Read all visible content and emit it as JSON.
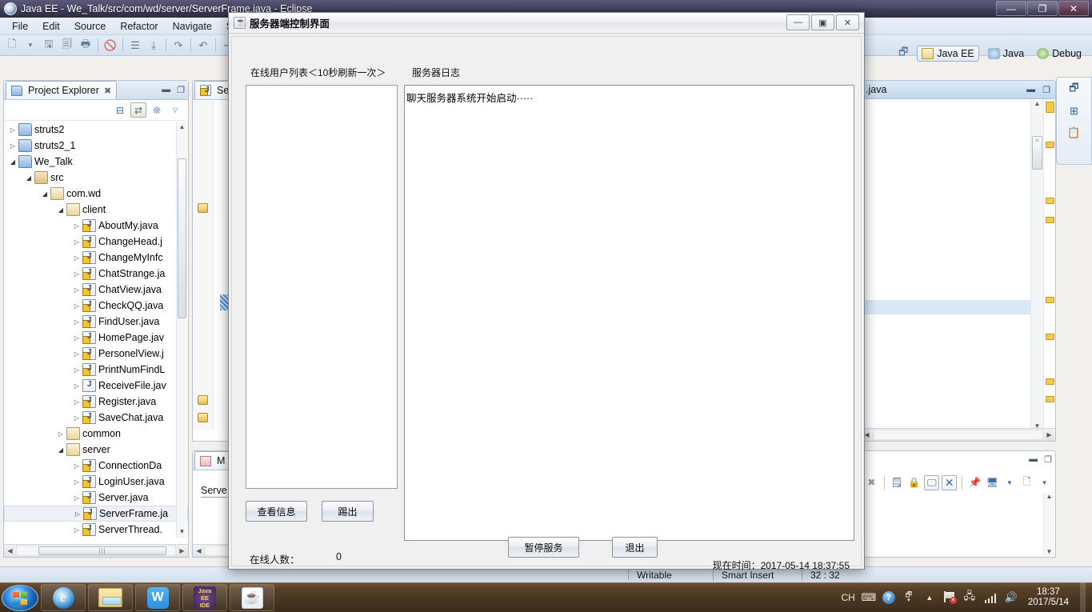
{
  "eclipse": {
    "title": "Java EE - We_Talk/src/com/wd/server/ServerFrame.java - Eclipse",
    "window_buttons": {
      "minimize": "—",
      "maximize": "❐",
      "close": "✕"
    },
    "menu": [
      "File",
      "Edit",
      "Source",
      "Refactor",
      "Navigate",
      "Sea"
    ],
    "perspectives": [
      {
        "label": "Java EE",
        "active": true
      },
      {
        "label": "Java",
        "active": false
      },
      {
        "label": "Debug",
        "active": false
      }
    ],
    "project_explorer": {
      "tab_label": "Project Explorer",
      "tab_close": "✖",
      "tree": [
        {
          "label": "struts2",
          "indent": 0,
          "arrow": "closed",
          "icon": "project-icon"
        },
        {
          "label": "struts2_1",
          "indent": 0,
          "arrow": "closed",
          "icon": "project-icon"
        },
        {
          "label": "We_Talk",
          "indent": 0,
          "arrow": "open",
          "icon": "project-icon"
        },
        {
          "label": "src",
          "indent": 1,
          "arrow": "open",
          "icon": "source-folder-icon"
        },
        {
          "label": "com.wd",
          "indent": 2,
          "arrow": "open",
          "icon": "package-icon"
        },
        {
          "label": "client",
          "indent": 3,
          "arrow": "open",
          "icon": "package-icon"
        },
        {
          "label": "AboutMy.java",
          "indent": 4,
          "arrow": "closed",
          "icon": "java-file-icon"
        },
        {
          "label": "ChangeHead.j",
          "indent": 4,
          "arrow": "closed",
          "icon": "java-file-icon"
        },
        {
          "label": "ChangeMyInfc",
          "indent": 4,
          "arrow": "closed",
          "icon": "java-file-icon"
        },
        {
          "label": "ChatStrange.ja",
          "indent": 4,
          "arrow": "closed",
          "icon": "java-file-icon"
        },
        {
          "label": "ChatView.java",
          "indent": 4,
          "arrow": "closed",
          "icon": "java-file-icon"
        },
        {
          "label": "CheckQQ.java",
          "indent": 4,
          "arrow": "closed",
          "icon": "java-file-icon"
        },
        {
          "label": "FindUser.java",
          "indent": 4,
          "arrow": "closed",
          "icon": "java-file-icon"
        },
        {
          "label": "HomePage.jav",
          "indent": 4,
          "arrow": "closed",
          "icon": "java-file-icon"
        },
        {
          "label": "PersonelView.j",
          "indent": 4,
          "arrow": "closed",
          "icon": "java-file-icon"
        },
        {
          "label": "PrintNumFindL",
          "indent": 4,
          "arrow": "closed",
          "icon": "java-file-icon"
        },
        {
          "label": "ReceiveFile.jav",
          "indent": 4,
          "arrow": "closed",
          "icon": "java-file-plain-icon"
        },
        {
          "label": "Register.java",
          "indent": 4,
          "arrow": "closed",
          "icon": "java-file-icon"
        },
        {
          "label": "SaveChat.java",
          "indent": 4,
          "arrow": "closed",
          "icon": "java-file-icon"
        },
        {
          "label": "common",
          "indent": 3,
          "arrow": "closed",
          "icon": "package-icon"
        },
        {
          "label": "server",
          "indent": 3,
          "arrow": "open",
          "icon": "package-icon"
        },
        {
          "label": "ConnectionDa",
          "indent": 4,
          "arrow": "closed",
          "icon": "java-file-icon"
        },
        {
          "label": "LoginUser.java",
          "indent": 4,
          "arrow": "closed",
          "icon": "java-file-icon"
        },
        {
          "label": "Server.java",
          "indent": 4,
          "arrow": "closed",
          "icon": "java-file-icon"
        },
        {
          "label": "ServerFrame.ja",
          "indent": 4,
          "arrow": "closed",
          "icon": "java-file-icon",
          "selected": true
        },
        {
          "label": "ServerThread.",
          "indent": 4,
          "arrow": "closed",
          "icon": "java-file-icon"
        }
      ]
    },
    "center_editor": {
      "tab_label": "Se"
    },
    "markers_view": {
      "tab_label": "M",
      "text": "Serve"
    },
    "right_editor": {
      "tab_label": ".java"
    },
    "statusbar": {
      "writable": "Writable",
      "insert_mode": "Smart Insert",
      "position": "32 : 32"
    }
  },
  "dialog": {
    "title": "服务器端控制界面",
    "window_buttons": {
      "minimize": "—",
      "maximize": "▣",
      "close": "✕"
    },
    "labels": {
      "online_users": "在线用户列表＜10秒刷新一次＞",
      "server_log": "服务器日志",
      "online_count_caption": "在线人数：",
      "online_count_value": "0",
      "current_time": "现在时间：2017-05-14 18:37:55"
    },
    "log_lines": [
      "聊天服务器系统开始启动·····"
    ],
    "user_list": [],
    "buttons": {
      "view_info": "查看信息",
      "kick_out": "踢出",
      "pause_service": "暂停服务",
      "exit": "退出"
    }
  },
  "taskbar": {
    "items": [
      {
        "name": "internet-explorer",
        "glyph": "e"
      },
      {
        "name": "file-explorer",
        "glyph": ""
      },
      {
        "name": "wps-office",
        "glyph": "W"
      },
      {
        "name": "java-ee-ide",
        "glyph": "Java EE IDE"
      },
      {
        "name": "java-application",
        "glyph": "☕"
      }
    ],
    "tray": {
      "ime": "CH",
      "icons": [
        "keyboard-icon",
        "help-icon",
        "show-hidden-icon",
        "action-center-icon",
        "network-icon",
        "signal-icon",
        "volume-icon"
      ],
      "clock_time": "18:37",
      "clock_date": "2017/5/14"
    }
  }
}
